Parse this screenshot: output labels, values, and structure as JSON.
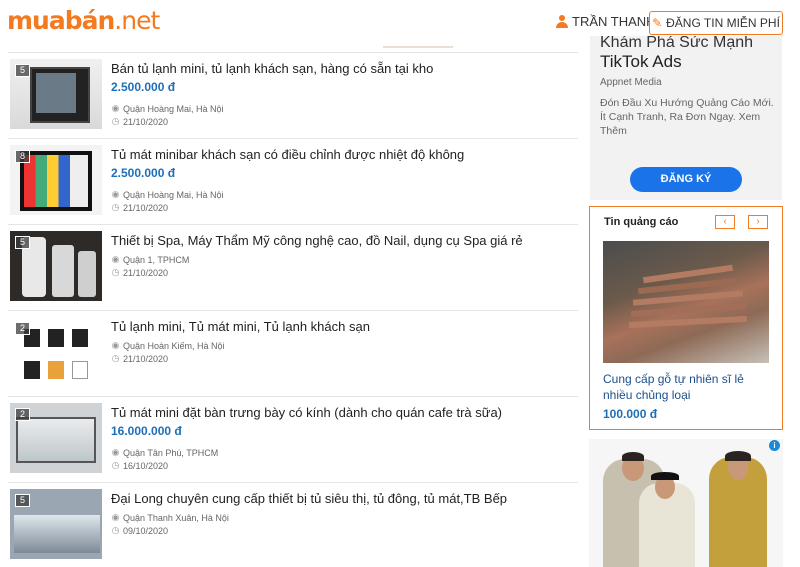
{
  "header": {
    "logo": "muabán.net",
    "logo_main": "muabán",
    "logo_tld": ".net",
    "user_name": "TRẦN THANH",
    "post_button": "ĐĂNG TIN MIỄN PHÍ",
    "icons": {
      "user": "user-icon",
      "post": "pencil-icon"
    },
    "accent_color": "#f47a20"
  },
  "listings": [
    {
      "photos": "5",
      "title": "Bán tủ lạnh mini, tủ lạnh khách sạn, hàng có sẵn tại kho",
      "price": "2.500.000 đ",
      "location": "Quận Hoàng Mai, Hà Nội",
      "date": "21/10/2020"
    },
    {
      "photos": "8",
      "title": "Tủ mát minibar khách sạn có điều chỉnh được nhiệt độ không",
      "price": "2.500.000 đ",
      "location": "Quận Hoàng Mai, Hà Nội",
      "date": "21/10/2020"
    },
    {
      "photos": "5",
      "title": "Thiết bị Spa, Máy Thẩm Mỹ công nghệ cao, đồ Nail, dụng cụ Spa giá rẻ",
      "price": "",
      "location": "Quận 1, TPHCM",
      "date": "21/10/2020"
    },
    {
      "photos": "2",
      "title": "Tủ lạnh mini, Tủ mát mini, Tủ lạnh khách sạn",
      "price": "",
      "location": "Quận Hoàn Kiếm, Hà Nội",
      "date": "21/10/2020"
    },
    {
      "photos": "2",
      "title": "Tủ mát mini đặt bàn trưng bày có kính (dành cho quán cafe trà sữa)",
      "price": "16.000.000 đ",
      "location": "Quận Tân Phú, TPHCM",
      "date": "16/10/2020"
    },
    {
      "photos": "5",
      "title": "Đại Long chuyên cung cấp thiết bị tủ siêu thị, tủ đông, tủ mát,TB Bếp",
      "price": "",
      "location": "Quận Thanh Xuân, Hà Nội",
      "date": "09/10/2020"
    }
  ],
  "ad_tiktok": {
    "headline_partial": "Khám Phá Sức Mạnh",
    "headline": "TikTok Ads",
    "source": "Appnet Media",
    "description": "Đón Đầu Xu Hướng Quảng Cáo Mới. Ít Cạnh Tranh, Ra Đơn Ngay. Xem Thêm",
    "cta": "ĐĂNG KÝ"
  },
  "promo": {
    "heading": "Tin quảng cáo",
    "prev_icon": "chevron-left-icon",
    "next_icon": "chevron-right-icon",
    "prev_glyph": "‹",
    "next_glyph": "›",
    "title": "Cung cấp gỗ tự nhiên sĩ lẻ nhiều chủng loại",
    "price": "100.000 đ"
  },
  "ad_fashion": {
    "choice_icon": "adchoices-icon",
    "choice_glyph": "i"
  }
}
